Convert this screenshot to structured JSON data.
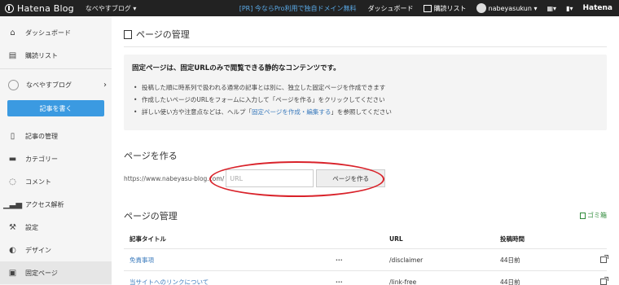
{
  "topbar": {
    "brand": "Hatena Blog",
    "blog_switch": "なべやすブログ ▾",
    "pr_link": "[PR] 今ならPro利用で独自ドメイン無料",
    "dashboard": "ダッシュボード",
    "reading_list": "購読リスト",
    "user": "nabeyasukun ▾",
    "hatena": "Hatena"
  },
  "sidebar": {
    "items_top": [
      {
        "label": "ダッシュボード",
        "icon": "home-icon"
      },
      {
        "label": "購読リスト",
        "icon": "reading-list-icon"
      }
    ],
    "blog_name": "なべやすブログ",
    "write_button": "記事を書く",
    "items": [
      {
        "label": "記事の管理",
        "icon": "document-icon"
      },
      {
        "label": "カテゴリー",
        "icon": "folder-icon"
      },
      {
        "label": "コメント",
        "icon": "comment-icon"
      },
      {
        "label": "アクセス解析",
        "icon": "bar-chart-icon"
      },
      {
        "label": "設定",
        "icon": "wrench-icon"
      },
      {
        "label": "デザイン",
        "icon": "palette-icon"
      },
      {
        "label": "固定ページ",
        "icon": "page-icon"
      }
    ]
  },
  "main": {
    "title": "ページの管理",
    "info": {
      "heading": "固定ページは、固定URLのみで閲覧できる静的なコンテンツです。",
      "bullets": [
        "投稿した順に時系列で扱われる通常の記事とは別に、独立した固定ページを作成できます",
        "作成したいページのURLをフォームに入力して「ページを作る」をクリックしてください"
      ],
      "bullet3_pre": "詳しい使い方や注意点などは、ヘルプ「",
      "bullet3_link": "固定ページを作成・編集する",
      "bullet3_post": "」を参照してください"
    },
    "create": {
      "heading": "ページを作る",
      "url_prefix": "https://www.nabeyasu-blog.com/",
      "url_placeholder": "URL",
      "button": "ページを作る"
    },
    "manage": {
      "heading": "ページの管理",
      "trash": "ゴミ箱",
      "columns": [
        "記事タイトル",
        "URL",
        "投稿時間"
      ],
      "rows": [
        {
          "title": "免責事項",
          "menu": "···",
          "url": "/disclaimer",
          "time": "44日前"
        },
        {
          "title": "当サイトへのリンクについて",
          "menu": "···",
          "url": "/link-free",
          "time": "44日前"
        }
      ]
    }
  }
}
